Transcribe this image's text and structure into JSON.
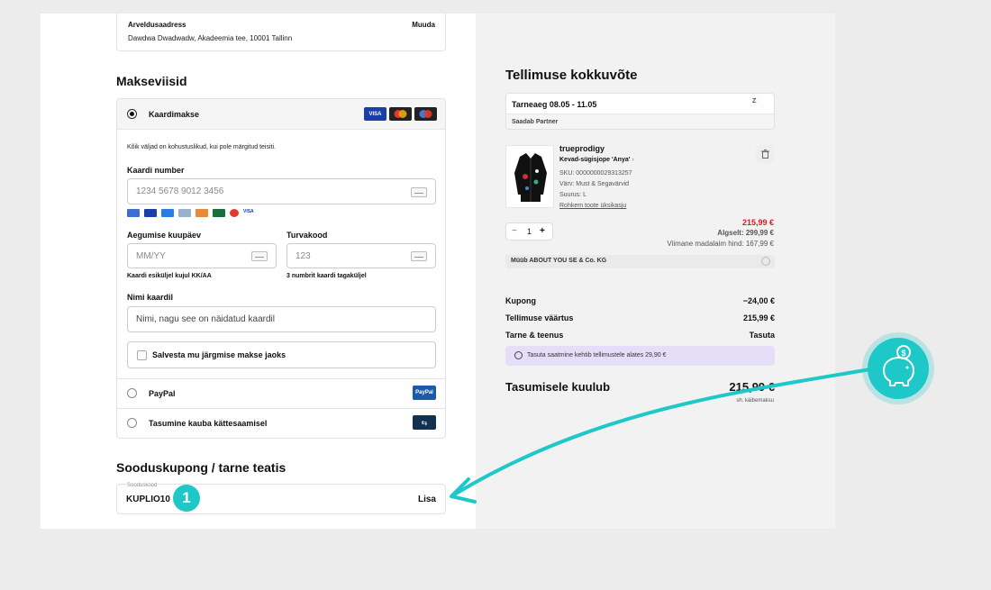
{
  "billing": {
    "label": "Arveldusaadress",
    "change": "Muuda",
    "address": "Dawdwa Dwadwadw, Akadeemia tee, 10001 Tallinn"
  },
  "payment": {
    "title": "Makseviisid",
    "card_option": "Kaardimakse",
    "required_note": "Kõik väljad on kohustuslikud, kui pole märgitud teisiti.",
    "card_number_label": "Kaardi number",
    "card_number_placeholder": "1234 5678 9012 3456",
    "expiry_label": "Aegumise kuupäev",
    "expiry_placeholder": "MM/YY",
    "expiry_hint": "Kaardi esiküljel kujul KK/AA",
    "cvv_label": "Turvakood",
    "cvv_placeholder": "123",
    "cvv_hint": "3 numbrit kaardi tagaküljel",
    "name_label": "Nimi kaardil",
    "name_placeholder": "Nimi, nagu see on näidatud kaardil",
    "save_label": "Salvesta mu järgmise makse jaoks",
    "paypal_option": "PayPal",
    "paypal_logo": "PayPal",
    "cod_option": "Tasumine kauba kättesaamisel",
    "card_logos": [
      {
        "name": "VISA",
        "color": "#1a3fa8"
      },
      {
        "name": "Mastercard",
        "color": "#222222"
      },
      {
        "name": "Maestro",
        "color": "#222222"
      }
    ]
  },
  "coupon": {
    "title": "Sooduskupong / tarne teatis",
    "field_label": "Sooduskood",
    "value": "KUPLIO10",
    "add": "Lisa",
    "badge_number": "1"
  },
  "summary": {
    "title": "Tellimuse kokkuvõte",
    "delivery": "Tarneaeg 08.05 - 11.05",
    "delivery_logo": "Z",
    "sent_by": "Saadab Partner",
    "product": {
      "brand": "trueprodigy",
      "name": "Kevad-sügisjope 'Anya'",
      "sku": "SKU: 0000000029313257",
      "color": "Värv: Must & Segavärvid",
      "size": "Suurus: L",
      "details_link": "Rohkem toote üksikasju",
      "qty": "1",
      "price": "215,99 €",
      "original_price": "Algselt: 299,99 €",
      "lowest_price": "Viimane madalaim hind: 167,99 €"
    },
    "seller": "Müüb ABOUT YOU SE & Co. KG",
    "coupon_label": "Kupong",
    "coupon_value": "−24,00 €",
    "order_value_label": "Tellimuse väärtus",
    "order_value": "215,99 €",
    "shipping_label": "Tarne & teenus",
    "shipping_value": "Tasuta",
    "free_shipping_note": "Tasuta saatmine kehtib tellimustele alates 29,90 €",
    "total_label": "Tasumisele kuulub",
    "total_value": "215,99 €",
    "vat_note": "sh. käibemaksu"
  },
  "colors": {
    "accent_teal": "#1ec8c8",
    "price_red": "#d02020",
    "info_purple": "#e6def8"
  }
}
